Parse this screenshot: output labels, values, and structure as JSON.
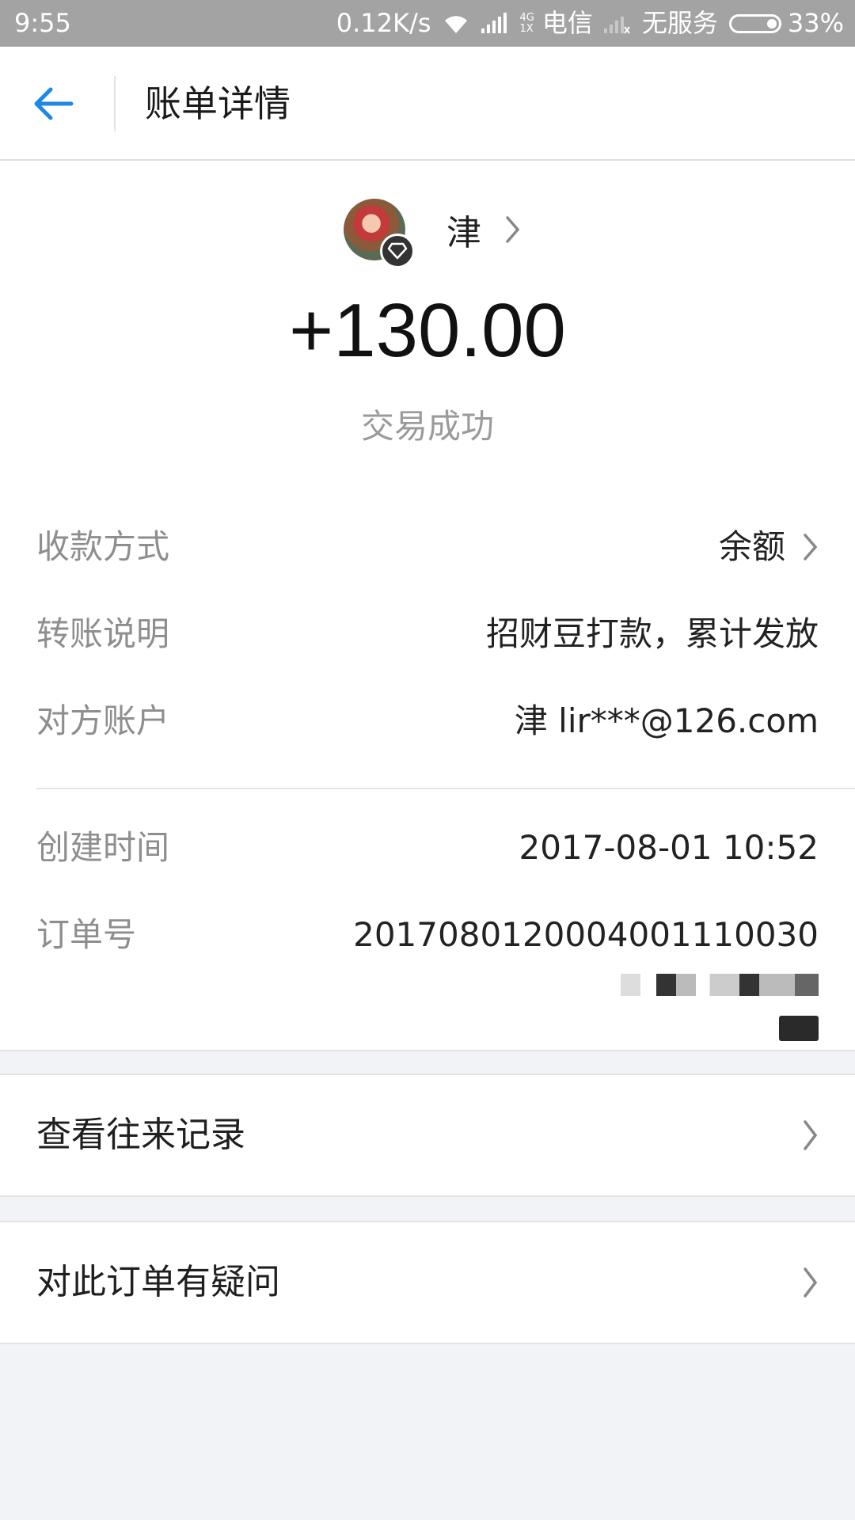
{
  "status_bar": {
    "time": "9:55",
    "speed": "0.12K/s",
    "net_top": "4G",
    "net_bottom": "1X",
    "carrier": "电信",
    "no_service": "无服务",
    "battery": "33%"
  },
  "header": {
    "title": "账单详情"
  },
  "transaction": {
    "payer_name": "津",
    "amount": "+130.00",
    "status": "交易成功"
  },
  "details": [
    {
      "label": "收款方式",
      "value": "余额"
    },
    {
      "label": "转账说明",
      "value": "招财豆打款，累计发放"
    },
    {
      "label": "对方账户",
      "value": "津 lir***@126.com"
    },
    {
      "label": "创建时间",
      "value": "2017-08-01 10:52"
    },
    {
      "label": "订单号",
      "value": "2017080120004001110030"
    }
  ],
  "actions": {
    "history": "查看往来记录",
    "dispute": "对此订单有疑问"
  },
  "colors": {
    "accent": "#1e88e5",
    "status_bar": "#a3a3a3",
    "background": "#f2f3f7"
  }
}
